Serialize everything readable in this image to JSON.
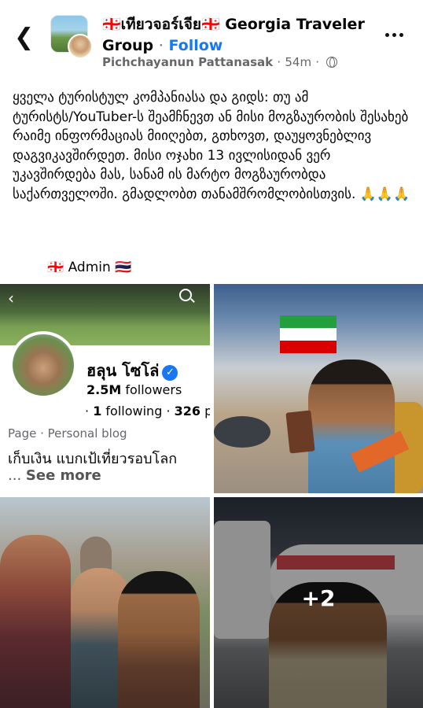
{
  "header": {
    "back_icon": "chevron-left-icon",
    "group_name": "🇬🇪เทียวจอร์เจีย🇬🇪 Georgia Traveler Group",
    "dot": "·",
    "follow_label": "Follow",
    "author": "Pichchayanun Pattanasak",
    "separator": "·",
    "time": "54m",
    "privacy_icon": "globe-icon",
    "more_icon": "more-horizontal-icon"
  },
  "post": {
    "text": "ყველა ტურისტულ კომპანიასა და გიდს: თუ ამ ტურისტს/YouTuber-ს შეამჩნევთ ან მისი მოგზაურობის შესახებ რაიმე ინფორმაციას მიიღებთ, გთხოვთ, დაუყოვნებლივ დაგვიკავშირდეთ. მისი ოჯახი 13 ივლისიდან ვერ უკავშირდება მას, სანამ ის მარტო მოგზაურობდა საქართველოში. გმადლობთ თანამშრომლობისთვის. 🙏🙏🙏",
    "signature": "🇬🇪   Admin 🇹🇭"
  },
  "photos": {
    "profile": {
      "name": "ฮลุน โซโล่",
      "verified_icon": "verified-badge-icon",
      "followers_count": "2.5M",
      "followers_label": "followers",
      "following_prefix": "·",
      "following_count": "1",
      "following_label": "following ·",
      "posts_count": "326",
      "posts_suffix": "p",
      "page_type": "Page · Personal blog",
      "bio": "เก็บเงิน แบกเป้เที่ยวรอบโลก",
      "see_more_prefix": "...",
      "see_more": "See more"
    },
    "more_count": "+2"
  },
  "colors": {
    "accent": "#1877f2",
    "secondary_text": "#65676b",
    "iran_green": "#239f40",
    "iran_red": "#da0000"
  }
}
